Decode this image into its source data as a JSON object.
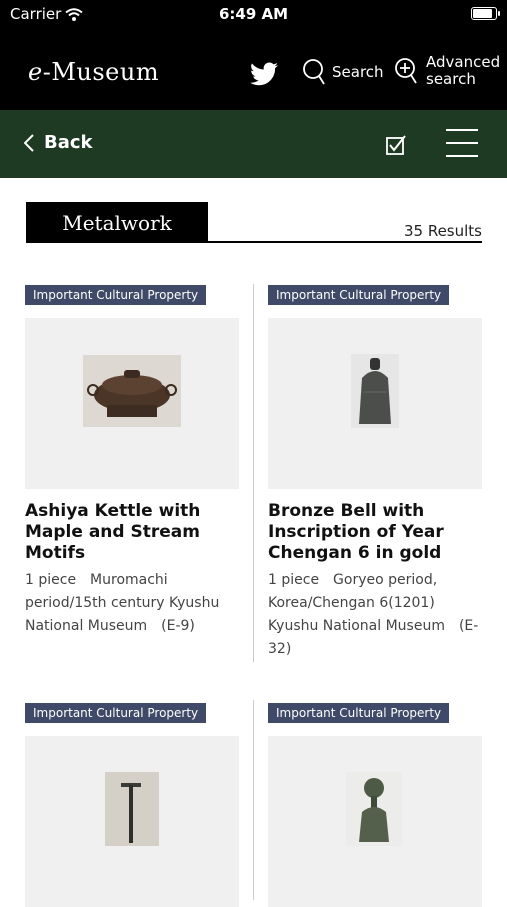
{
  "status": {
    "carrier": "Carrier",
    "time": "6:49 AM",
    "battery_level": 0.95
  },
  "header": {
    "logo_prefix": "e",
    "logo_text": "-Museum",
    "search_label": "Search",
    "advanced_line1": "Advanced",
    "advanced_line2": "search"
  },
  "nav": {
    "back_label": "Back"
  },
  "category": {
    "title": "Metalwork",
    "results": "35 Results"
  },
  "cards": [
    {
      "badge": "Important Cultural Property",
      "title": "Ashiya Kettle with Maple and Stream Motifs",
      "meta": "1 piece　Muromachi period/15th century Kyushu National Museum　(E-9)"
    },
    {
      "badge": "Important Cultural Property",
      "title": "Bronze Bell with Inscription of Year Chengan 6 in gold",
      "meta": "1 piece　Goryeo period, Korea/Chengan 6(1201) Kyushu National Museum　(E-32)"
    },
    {
      "badge": "Important Cultural Property",
      "title": "",
      "meta": ""
    },
    {
      "badge": "Important Cultural Property",
      "title": "",
      "meta": ""
    }
  ]
}
